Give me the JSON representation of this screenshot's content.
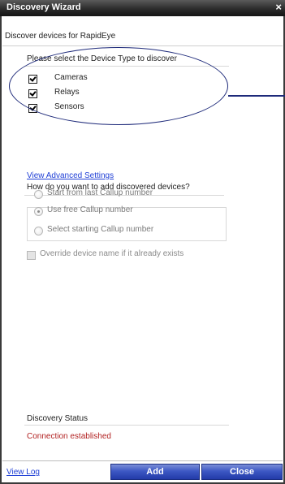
{
  "window": {
    "title": "Discovery Wizard",
    "close_glyph": "×",
    "subtitle": "Discover devices for RapidEye"
  },
  "device_types": {
    "prompt": "Please select the Device Type to discover",
    "items": [
      {
        "label": "Cameras",
        "checked": true
      },
      {
        "label": "Relays",
        "checked": true
      },
      {
        "label": "Sensors",
        "checked": true
      }
    ]
  },
  "advanced": {
    "link_label": "View Advanced Settings",
    "prompt": "How do you want to  add discovered devices?",
    "options": [
      {
        "label": "Start from last Callup number",
        "selected": false
      },
      {
        "label": "Use free Callup number",
        "selected": true
      },
      {
        "label": "Select starting Callup number",
        "selected": false
      }
    ],
    "override_label": "Override device name if it already exists",
    "override_checked": false
  },
  "status": {
    "title": "Discovery Status",
    "text": "Connection established",
    "text_color": "#b22222"
  },
  "footer": {
    "view_log_label": "View Log",
    "add_label": "Add",
    "close_label": "Close"
  },
  "colors": {
    "title_bar": "#2c2c2c",
    "link": "#1f3fd6",
    "button": "#3d58c4",
    "callout": "#1e2a7a"
  }
}
